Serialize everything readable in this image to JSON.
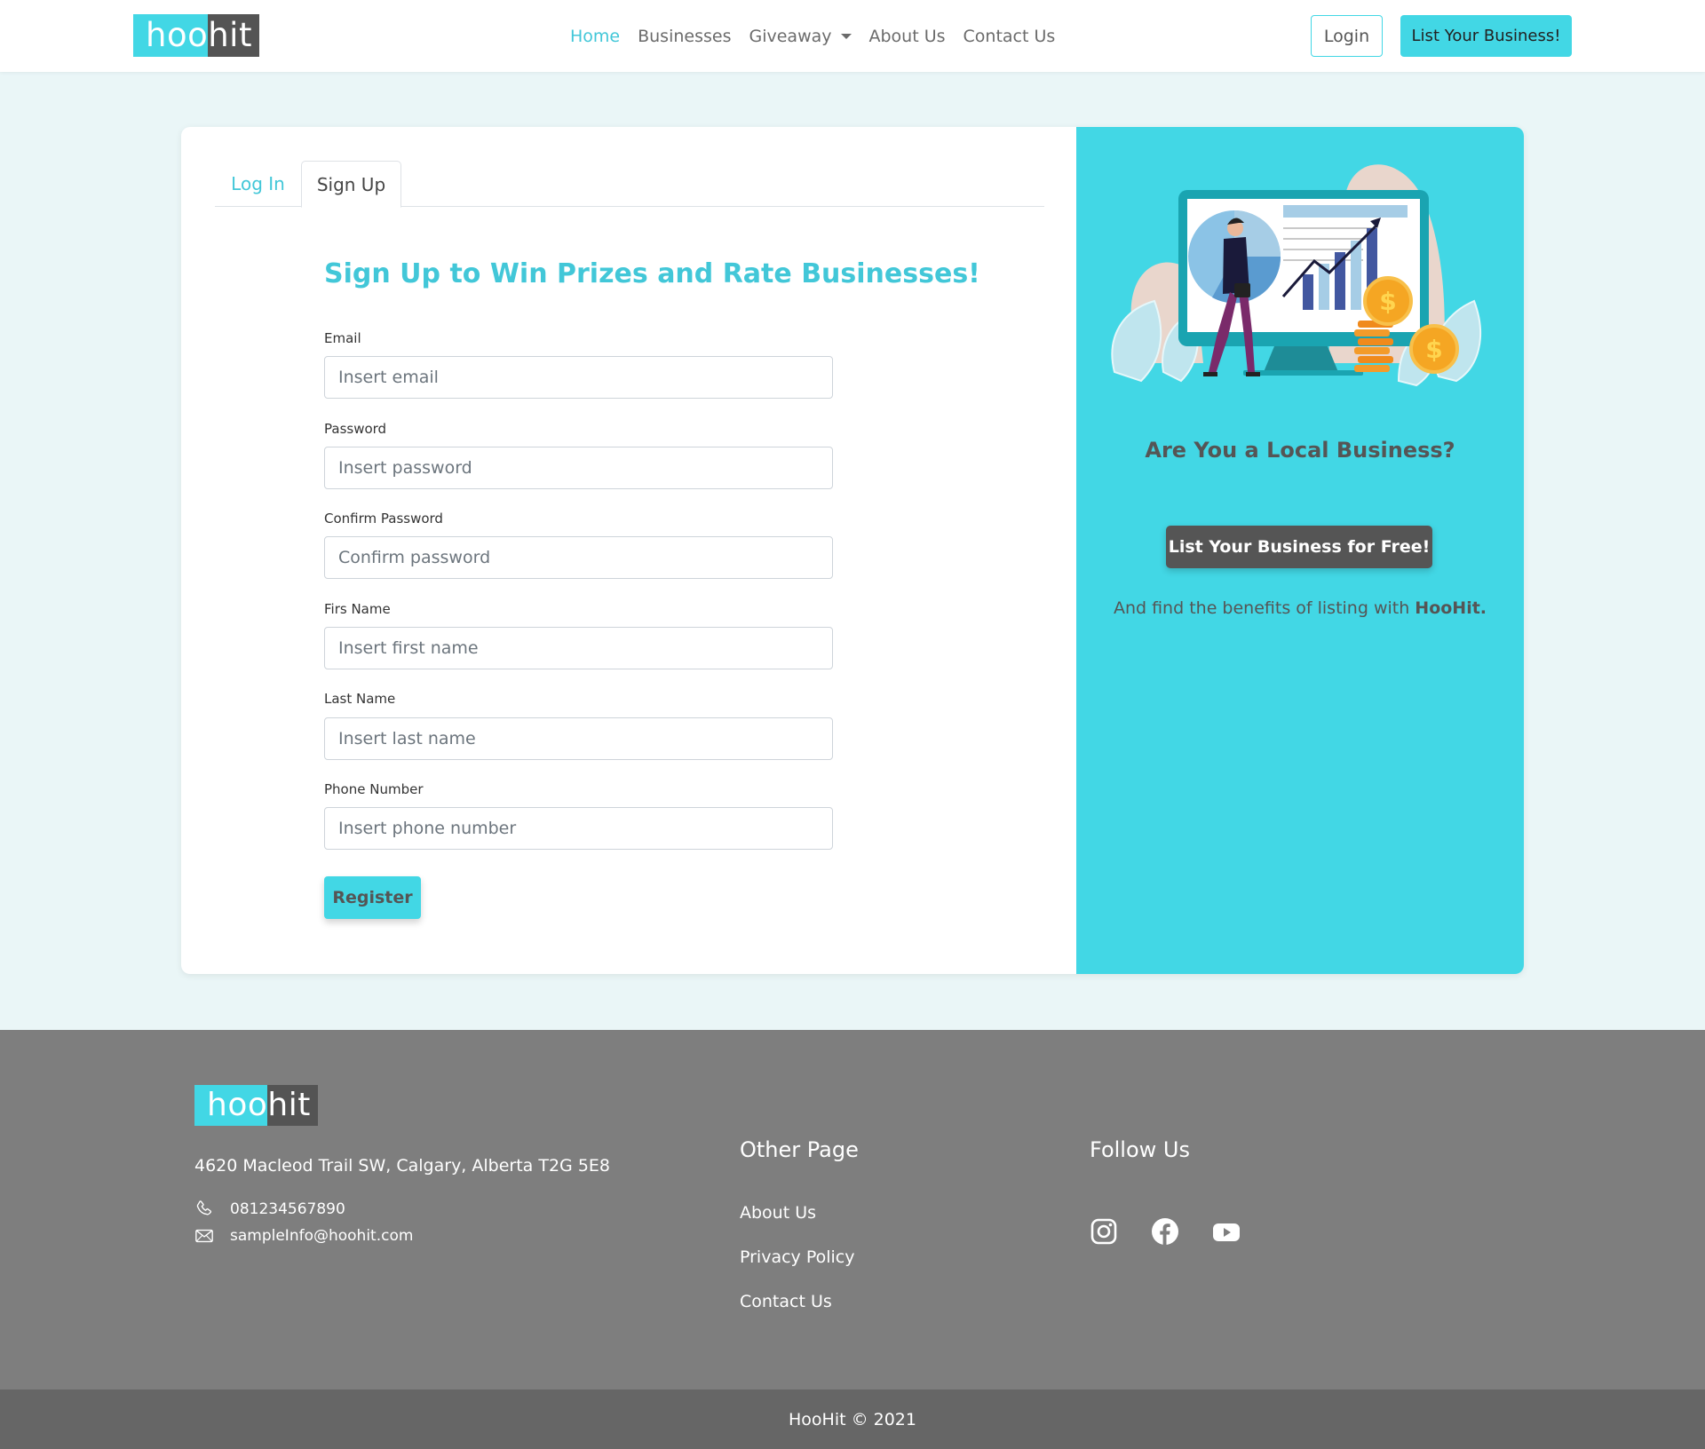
{
  "brand": {
    "logo_part1": "hoo",
    "logo_part2": "hit"
  },
  "nav": {
    "links": [
      {
        "label": "Home"
      },
      {
        "label": "Businesses"
      },
      {
        "label": "Giveaway"
      },
      {
        "label": "About Us"
      },
      {
        "label": "Contact Us"
      }
    ],
    "login_label": "Login",
    "list_business_label": "List Your Business!"
  },
  "tabs": {
    "login": "Log In",
    "signup": "Sign Up"
  },
  "form": {
    "title": "Sign Up to Win Prizes and Rate Businesses!",
    "fields": [
      {
        "label": "Email",
        "placeholder": "Insert email"
      },
      {
        "label": "Password",
        "placeholder": "Insert password"
      },
      {
        "label": "Confirm Password",
        "placeholder": "Confirm password"
      },
      {
        "label": "Firs Name",
        "placeholder": "Insert first name"
      },
      {
        "label": "Last Name",
        "placeholder": "Insert last name"
      },
      {
        "label": "Phone Number",
        "placeholder": "Insert phone number"
      }
    ],
    "register_label": "Register"
  },
  "promo": {
    "title": "Are You a Local Business?",
    "button_label": "List Your Business for Free!",
    "note_prefix": "And find the benefits of listing with ",
    "note_brand": "HooHit."
  },
  "footer": {
    "address": "4620 Macleod Trail SW, Calgary, Alberta T2G 5E8",
    "phone": "081234567890",
    "email": "sampleInfo@hoohit.com",
    "other_page_title": "Other Page",
    "other_links": [
      {
        "label": "About Us"
      },
      {
        "label": "Privacy Policy"
      },
      {
        "label": "Contact Us"
      }
    ],
    "follow_title": "Follow Us",
    "social_icons": [
      "instagram-icon",
      "facebook-icon",
      "youtube-icon"
    ],
    "copyright": "HooHit © 2021"
  },
  "colors": {
    "accent": "#42d7e5",
    "dark": "#545454",
    "footer": "#7e7e7e",
    "bottom_bar": "#666666",
    "page_bg": "#eaf6f7"
  }
}
